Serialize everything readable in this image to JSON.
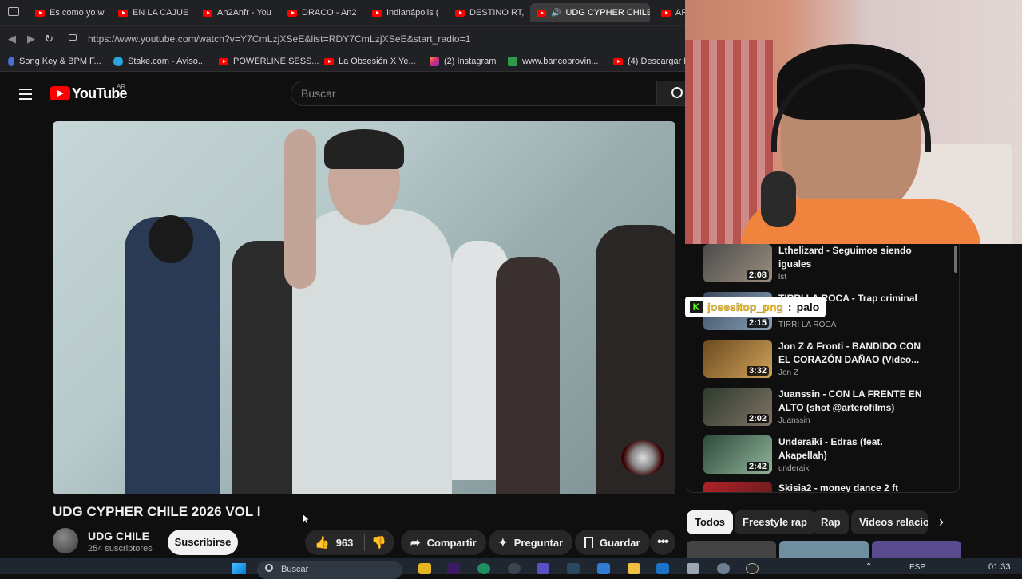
{
  "browser": {
    "tabs": [
      {
        "label": "Es como yo w",
        "active": false
      },
      {
        "label": "EN LA CAJUE",
        "active": false
      },
      {
        "label": "An2Anfr - You",
        "active": false
      },
      {
        "label": "DRACO - An2",
        "active": false
      },
      {
        "label": "Indianápolis (",
        "active": false
      },
      {
        "label": "DESTINO RT,",
        "active": false
      },
      {
        "label": "UDG CYPHER CHILE",
        "active": true
      },
      {
        "label": "AF",
        "active": false
      }
    ],
    "url": "https://www.youtube.com/watch?v=Y7CmLzjXSeE&list=RDY7CmLzjXSeE&start_radio=1",
    "bookmarks": [
      {
        "label": "Song Key & BPM F...",
        "icon": "music-note-icon"
      },
      {
        "label": "Stake.com - Aviso...",
        "icon": "telegram-icon"
      },
      {
        "label": "POWERLINE SESS...",
        "icon": "youtube-icon"
      },
      {
        "label": "La Obsesión X Ye...",
        "icon": "youtube-icon"
      },
      {
        "label": "(2) Instagram",
        "icon": "instagram-icon"
      },
      {
        "label": "www.bancoprovin...",
        "icon": "bank-icon"
      },
      {
        "label": "(4) Descargar B",
        "icon": "youtube-icon"
      }
    ]
  },
  "youtube": {
    "logo_text": "YouTube",
    "country": "AR",
    "search_placeholder": "Buscar",
    "video": {
      "title": "UDG CYPHER CHILE 2026 VOL I",
      "channel": "UDG CHILE",
      "subscribers": "254 suscriptores",
      "subscribe_label": "Suscribirse",
      "likes": "963",
      "share_label": "Compartir",
      "ask_label": "Preguntar",
      "save_label": "Guardar"
    },
    "recommendations": [
      {
        "title": "Lthelizard - Seguimos siendo iguales",
        "channel": "lst",
        "duration": "2:08"
      },
      {
        "title": "TIRRI LA ROCA - Trap criminal",
        "channel": "TIRRI LA ROCA",
        "duration": "2:15"
      },
      {
        "title": "Jon Z & Fronti - BANDIDO CON EL CORAZÓN DAÑAO (Video...",
        "channel": "Jon Z",
        "duration": "3:32"
      },
      {
        "title": "Juanssin - CON LA FRENTE EN ALTO (shot @arterofilms)",
        "channel": "Juanssin",
        "duration": "2:02"
      },
      {
        "title": "Underaiki - Edras (feat. Akapellah)",
        "channel": "underaiki",
        "duration": "2:42"
      },
      {
        "title": "Skisia2 - money dance 2 ft",
        "channel": "",
        "duration": ""
      }
    ],
    "chips": [
      {
        "label": "Todos",
        "active": true
      },
      {
        "label": "Freestyle rap",
        "active": false
      },
      {
        "label": "Rap",
        "active": false
      },
      {
        "label": "Videos relacion",
        "active": false
      }
    ]
  },
  "chat": {
    "user": "josesitop_png",
    "separator": ":",
    "message": "palo",
    "badge": "K"
  },
  "taskbar": {
    "search_placeholder": "Buscar",
    "language": "ESP",
    "time": "01:33"
  }
}
